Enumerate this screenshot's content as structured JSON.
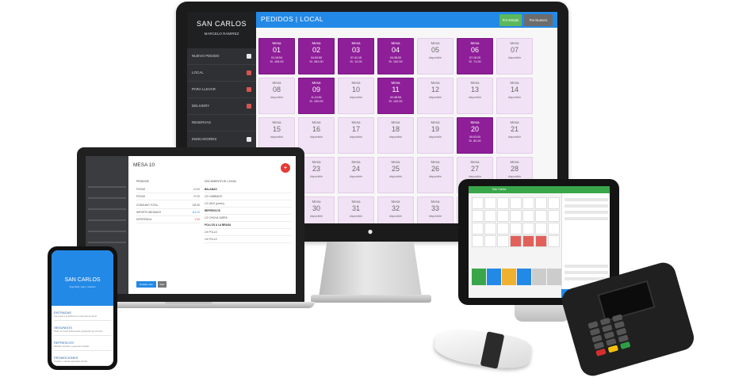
{
  "monitor": {
    "brand_title": "SAN CARLOS",
    "brand_user": "MARCELO RAMIREZ",
    "menu": [
      {
        "label": "NUEVO PEDIDO",
        "icon": "mobile-icon"
      },
      {
        "label": "LOCAL",
        "icon": "badge-icon"
      },
      {
        "label": "PARA LLEVAR",
        "icon": "badge-icon"
      },
      {
        "label": "DELIVERY",
        "icon": "badge-icon"
      },
      {
        "label": "RESERVAS",
        "icon": ""
      },
      {
        "label": "INDICADORES",
        "icon": "chart-icon"
      }
    ],
    "page_title": "PEDIDOS | LOCAL",
    "btn_estado": "Por Estado",
    "btn_numero": "Por Numero",
    "tables": [
      {
        "label": "Mesa",
        "num": "01",
        "busy": true,
        "status": "01:15:54",
        "amount": "S/. 195.00"
      },
      {
        "label": "Mesa",
        "num": "02",
        "busy": true,
        "status": "04:00:55",
        "amount": "S/. 281.00"
      },
      {
        "label": "Mesa",
        "num": "03",
        "busy": true,
        "status": "07:41:15",
        "amount": "S/. 12.00"
      },
      {
        "label": "Mesa",
        "num": "04",
        "busy": true,
        "status": "04:35:00",
        "amount": "S/. 142.00"
      },
      {
        "label": "Mesa",
        "num": "05",
        "busy": false,
        "status": "disponible",
        "amount": ""
      },
      {
        "label": "Mesa",
        "num": "06",
        "busy": true,
        "status": "07:15:29",
        "amount": "S/. 71.00"
      },
      {
        "label": "Mesa",
        "num": "07",
        "busy": false,
        "status": "disponible",
        "amount": ""
      },
      {
        "label": "Mesa",
        "num": "08",
        "busy": false,
        "status": "disponible",
        "amount": ""
      },
      {
        "label": "Mesa",
        "num": "09",
        "busy": true,
        "status": "11:14:51",
        "amount": "S/. 100.00"
      },
      {
        "label": "Mesa",
        "num": "10",
        "busy": false,
        "status": "disponible",
        "amount": ""
      },
      {
        "label": "Mesa",
        "num": "11",
        "busy": true,
        "status": "02:48:06",
        "amount": "S/. 142.00"
      },
      {
        "label": "Mesa",
        "num": "12",
        "busy": false,
        "status": "disponible",
        "amount": ""
      },
      {
        "label": "Mesa",
        "num": "13",
        "busy": false,
        "status": "disponible",
        "amount": ""
      },
      {
        "label": "Mesa",
        "num": "14",
        "busy": false,
        "status": "disponible",
        "amount": ""
      },
      {
        "label": "Mesa",
        "num": "15",
        "busy": false,
        "status": "disponible",
        "amount": ""
      },
      {
        "label": "Mesa",
        "num": "16",
        "busy": false,
        "status": "disponible",
        "amount": ""
      },
      {
        "label": "Mesa",
        "num": "17",
        "busy": false,
        "status": "disponible",
        "amount": ""
      },
      {
        "label": "Mesa",
        "num": "18",
        "busy": false,
        "status": "disponible",
        "amount": ""
      },
      {
        "label": "Mesa",
        "num": "19",
        "busy": false,
        "status": "disponible",
        "amount": ""
      },
      {
        "label": "Mesa",
        "num": "20",
        "busy": true,
        "status": "00:03:00",
        "amount": "S/. 82.00"
      },
      {
        "label": "Mesa",
        "num": "21",
        "busy": false,
        "status": "disponible",
        "amount": ""
      },
      {
        "label": "Mesa",
        "num": "",
        "busy": false,
        "status": "",
        "amount": ""
      },
      {
        "label": "Mesa",
        "num": "23",
        "busy": false,
        "status": "disponible",
        "amount": ""
      },
      {
        "label": "Mesa",
        "num": "24",
        "busy": false,
        "status": "disponible",
        "amount": ""
      },
      {
        "label": "Mesa",
        "num": "25",
        "busy": false,
        "status": "disponible",
        "amount": ""
      },
      {
        "label": "Mesa",
        "num": "26",
        "busy": false,
        "status": "disponible",
        "amount": ""
      },
      {
        "label": "Mesa",
        "num": "27",
        "busy": false,
        "status": "disponible",
        "amount": ""
      },
      {
        "label": "Mesa",
        "num": "28",
        "busy": false,
        "status": "disponible",
        "amount": ""
      },
      {
        "label": "Mesa",
        "num": "",
        "busy": false,
        "status": "",
        "amount": ""
      },
      {
        "label": "Mesa",
        "num": "30",
        "busy": false,
        "status": "disponible",
        "amount": ""
      },
      {
        "label": "Mesa",
        "num": "31",
        "busy": false,
        "status": "disponible",
        "amount": ""
      },
      {
        "label": "Mesa",
        "num": "32",
        "busy": false,
        "status": "disponible",
        "amount": ""
      },
      {
        "label": "Mesa",
        "num": "33",
        "busy": false,
        "status": "disponible",
        "amount": ""
      },
      {
        "label": "Mesa",
        "num": "",
        "busy": false,
        "status": "",
        "amount": ""
      }
    ]
  },
  "laptop": {
    "title": "MESA 10",
    "pedidos_label": "PEDIDOS",
    "document_label": "DOCUMENTO EL LOCAL",
    "items": [
      {
        "name": "PIZZAS",
        "value": "12.00"
      },
      {
        "name": "PIZZAS",
        "value": "27.00"
      }
    ],
    "summary": [
      {
        "label": "CONSUMO TOTAL",
        "value": "139.30"
      },
      {
        "label": "IMPORTE ABONADO",
        "value": "114.70"
      },
      {
        "label": "DIFERENCIA",
        "value": "2.00"
      }
    ],
    "groups": [
      {
        "title": "BALANAS",
        "rows": [
          "1/2 CAMBIADO",
          "1/2 VALE (precio)"
        ]
      },
      {
        "title": "REFRESCOS",
        "rows": [
          "1/2 CHICHA JARRA"
        ]
      },
      {
        "title": "POLLOS A LA BRASA",
        "rows": [
          "1/4 POLLO",
          "1/4 POLLO"
        ]
      }
    ],
    "btn_primary": "Pedido Listo",
    "btn_secondary": "Salir"
  },
  "phone": {
    "title": "SAN CARLOS",
    "subtitle": "Seguridad, sabor, tradición",
    "sections": [
      {
        "title": "ENTRADAS",
        "desc": "Las mejores entradas de la casa para empezar"
      },
      {
        "title": "SEGUNDOS",
        "desc": "Platos de fondo tradicionales preparados al momento"
      },
      {
        "title": "REFRESCOS",
        "desc": "Bebidas naturales y gaseosas heladas"
      },
      {
        "title": "PROMOCIONES",
        "desc": "Combos y ofertas especiales del día"
      }
    ]
  },
  "tablet": {
    "app_title": "San Carlos",
    "accent": "#3aa64a",
    "total_color": "#2389e6"
  },
  "colors": {
    "busy": "#8e1f98",
    "free": "#f1e2f5",
    "primary": "#2389e6",
    "success": "#5cb85c",
    "danger": "#d9534f"
  }
}
